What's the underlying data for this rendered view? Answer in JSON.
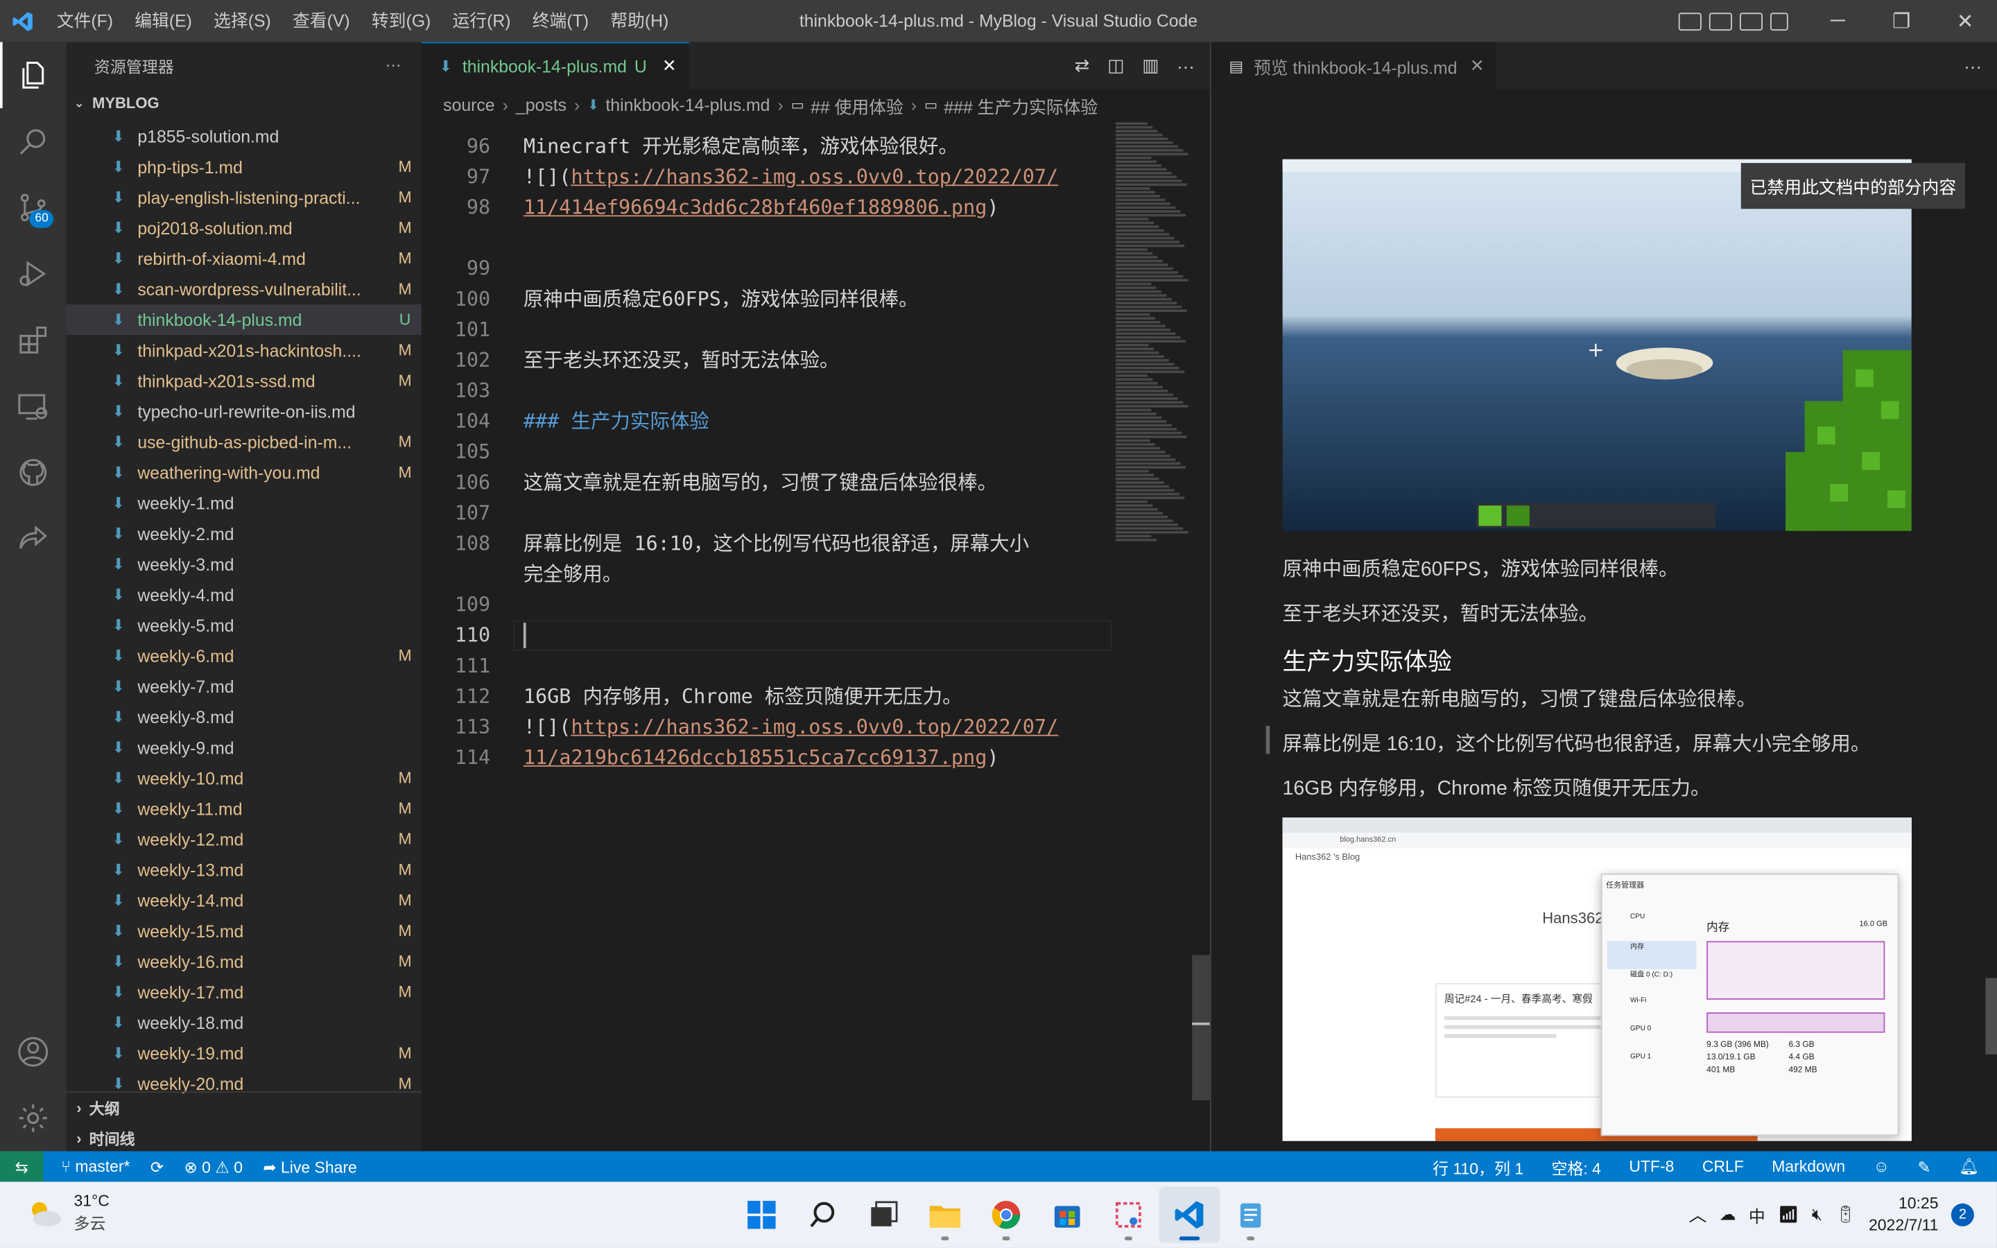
{
  "titlebar": {
    "menu": [
      "文件(F)",
      "编辑(E)",
      "选择(S)",
      "查看(V)",
      "转到(G)",
      "运行(R)",
      "终端(T)",
      "帮助(H)"
    ],
    "title": "thinkbook-14-plus.md - MyBlog - Visual Studio Code"
  },
  "activity": {
    "scm_badge": "60"
  },
  "sidebar": {
    "header": "资源管理器",
    "more": "···",
    "root": "MYBLOG",
    "files": [
      {
        "name": "p1855-solution.md",
        "status": ""
      },
      {
        "name": "php-tips-1.md",
        "status": "M"
      },
      {
        "name": "play-english-listening-practi...",
        "status": "M"
      },
      {
        "name": "poj2018-solution.md",
        "status": "M"
      },
      {
        "name": "rebirth-of-xiaomi-4.md",
        "status": "M"
      },
      {
        "name": "scan-wordpress-vulnerabilit...",
        "status": "M"
      },
      {
        "name": "thinkbook-14-plus.md",
        "status": "U"
      },
      {
        "name": "thinkpad-x201s-hackintosh....",
        "status": "M"
      },
      {
        "name": "thinkpad-x201s-ssd.md",
        "status": "M"
      },
      {
        "name": "typecho-url-rewrite-on-iis.md",
        "status": ""
      },
      {
        "name": "use-github-as-picbed-in-m...",
        "status": "M"
      },
      {
        "name": "weathering-with-you.md",
        "status": "M"
      },
      {
        "name": "weekly-1.md",
        "status": ""
      },
      {
        "name": "weekly-2.md",
        "status": ""
      },
      {
        "name": "weekly-3.md",
        "status": ""
      },
      {
        "name": "weekly-4.md",
        "status": ""
      },
      {
        "name": "weekly-5.md",
        "status": ""
      },
      {
        "name": "weekly-6.md",
        "status": "M"
      },
      {
        "name": "weekly-7.md",
        "status": ""
      },
      {
        "name": "weekly-8.md",
        "status": ""
      },
      {
        "name": "weekly-9.md",
        "status": ""
      },
      {
        "name": "weekly-10.md",
        "status": "M"
      },
      {
        "name": "weekly-11.md",
        "status": "M"
      },
      {
        "name": "weekly-12.md",
        "status": "M"
      },
      {
        "name": "weekly-13.md",
        "status": "M"
      },
      {
        "name": "weekly-14.md",
        "status": "M"
      },
      {
        "name": "weekly-15.md",
        "status": "M"
      },
      {
        "name": "weekly-16.md",
        "status": "M"
      },
      {
        "name": "weekly-17.md",
        "status": "M"
      },
      {
        "name": "weekly-18.md",
        "status": ""
      },
      {
        "name": "weekly-19.md",
        "status": "M"
      },
      {
        "name": "weekly-20.md",
        "status": "M"
      }
    ],
    "outline": "大纲",
    "timeline": "时间线"
  },
  "editor": {
    "tab_label": "thinkbook-14-plus.md",
    "tab_status": "U",
    "breadcrumb": [
      "source",
      "_posts",
      "thinkbook-14-plus.md",
      "## 使用体验",
      "### 生产力实际体验"
    ],
    "lines": [
      {
        "n": "96",
        "text": "Minecraft 开光影稳定高帧率，游戏体验很好。"
      },
      {
        "n": "97",
        "text": ""
      },
      {
        "n": "98",
        "prefix": "![](",
        "link": "https://hans362-img.oss.0vv0.top/2022/07/",
        "link2": "11/414ef96694c3dd6c28bf460ef1889806.png",
        "suffix": ")"
      },
      {
        "n": "99",
        "text": ""
      },
      {
        "n": "100",
        "text": "原神中画质稳定60FPS，游戏体验同样很棒。"
      },
      {
        "n": "101",
        "text": ""
      },
      {
        "n": "102",
        "text": "至于老头环还没买，暂时无法体验。"
      },
      {
        "n": "103",
        "text": ""
      },
      {
        "n": "104",
        "hashes": "###",
        "heading": "生产力实际体验"
      },
      {
        "n": "105",
        "text": ""
      },
      {
        "n": "106",
        "text": "这篇文章就是在新电脑写的，习惯了键盘后体验很棒。"
      },
      {
        "n": "107",
        "text": ""
      },
      {
        "n": "108",
        "text": "屏幕比例是 16:10，这个比例写代码也很舒适，屏幕大小",
        "text2": "完全够用。"
      },
      {
        "n": "109",
        "text": ""
      },
      {
        "n": "110",
        "text": ""
      },
      {
        "n": "111",
        "text": ""
      },
      {
        "n": "112",
        "text": "16GB 内存够用，Chrome 标签页随便开无压力。"
      },
      {
        "n": "113",
        "text": ""
      },
      {
        "n": "114",
        "prefix": "![](",
        "link": "https://hans362-img.oss.0vv0.top/2022/07/",
        "link2": "11/a219bc61426dccb18551c5ca7cc69137.png",
        "suffix": ")"
      }
    ]
  },
  "preview": {
    "tab_label": "预览 thinkbook-14-plus.md",
    "notice": "已禁用此文档中的部分内容",
    "p1": "原神中画质稳定60FPS，游戏体验同样很棒。",
    "p2": "至于老头环还没买，暂时无法体验。",
    "h3": "生产力实际体验",
    "p3": "这篇文章就是在新电脑写的，习惯了键盘后体验很棒。",
    "p4": "屏幕比例是 16:10，这个比例写代码也很舒适，屏幕大小完全够用。",
    "p5": "16GB 内存够用，Chrome 标签页随便开无压力。",
    "shot2": {
      "site": "Hans362 's Blog",
      "url": "blog.hans362.cn",
      "blog_name": "Hans362",
      "post": "周记#24 - 一月、春季高考、寒假",
      "tm_title": "任务管理器",
      "tm_mem": "内存",
      "tm_mem_size": "16.0 GB",
      "tm_items": [
        "CPU",
        "内存",
        "磁盘 0 (C: D:)",
        "Wi-Fi",
        "GPU 0",
        "GPU 1"
      ],
      "tm_vals": [
        "9.3 GB (396 MB)",
        "6.3 GB",
        "13.0/19.1 GB",
        "4.4 GB",
        "401 MB",
        "492 MB"
      ]
    }
  },
  "statusbar": {
    "branch": "master*",
    "errors": "0",
    "warnings": "0",
    "liveshare": "Live Share",
    "position": "行 110，列 1",
    "spaces": "空格: 4",
    "encoding": "UTF-8",
    "eol": "CRLF",
    "language": "Markdown"
  },
  "taskbar": {
    "temp": "31°C",
    "weather": "多云",
    "ime": "中",
    "time": "10:25",
    "date": "2022/7/11",
    "notifications": "2"
  }
}
